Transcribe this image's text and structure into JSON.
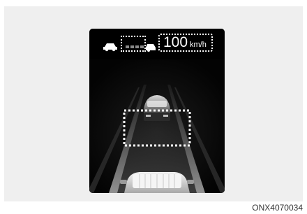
{
  "cluster_display": {
    "set_speed_value": "100",
    "set_speed_unit": "km/h",
    "gap_level_bars": 3
  },
  "figure_code": "ONX4070034",
  "colors": {
    "screen_bg": "#050505",
    "foreground": "#ffffff",
    "gap_bar": "#8a8a8a",
    "panel_bg": "#efefef"
  }
}
